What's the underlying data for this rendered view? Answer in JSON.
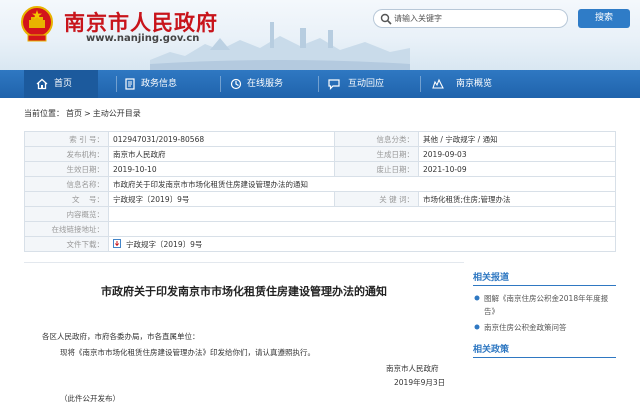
{
  "header": {
    "site_title": "南京市人民政府",
    "site_url": "www.nanjing.gov.cn",
    "search_placeholder": "请输入关键字",
    "search_button": "搜索"
  },
  "nav": {
    "items": [
      {
        "label": "首页",
        "icon": "home-icon",
        "active": true
      },
      {
        "label": "政务信息",
        "icon": "document-icon"
      },
      {
        "label": "在线服务",
        "icon": "service-icon"
      },
      {
        "label": "互动回应",
        "icon": "chat-icon"
      },
      {
        "label": "南京概览",
        "icon": "overview-icon"
      }
    ]
  },
  "breadcrumb": {
    "prefix": "当前位置：",
    "home": "首页",
    "sep": ">",
    "current": "主动公开目录"
  },
  "meta": {
    "index_no_label": "索 引 号：",
    "index_no": "012947031/2019-80568",
    "category_label": "信息分类：",
    "category": "其他 / 宁政规字 / 通知",
    "publisher_label": "发布机构：",
    "publisher": "南京市人民政府",
    "created_label": "生成日期：",
    "created": "2019-09-03",
    "effective_label": "生效日期：",
    "effective": "2019-10-10",
    "abolished_label": "废止日期：",
    "abolished": "2021-10-09",
    "name_label": "信息名称：",
    "name": "市政府关于印发南京市市场化租赁住房建设管理办法的通知",
    "docno_label": "文    号：",
    "docno": "宁政规字〔2019〕9号",
    "keywords_label": "关 键 词：",
    "keywords": "市场化租赁;住房;管理办法",
    "summary_label": "内容概览：",
    "summary": "",
    "online_link_label": "在线链接地址：",
    "online_link": "",
    "download_label": "文件下载：",
    "download": "宁政规字〔2019〕9号"
  },
  "article": {
    "title": "市政府关于印发南京市市场化租赁住房建设管理办法的通知",
    "salutation": "各区人民政府，市府各委办局，市各直属单位：",
    "body": "现将《南京市市场化租赁住房建设管理办法》印发给你们，请认真遵照执行。",
    "signature": "南京市人民政府",
    "date": "2019年9月3日",
    "note": "（此件公开发布）"
  },
  "sidebar": {
    "related_reports_title": "相关报道",
    "related_reports": [
      "图解《南京住房公积金2018年年度报告》",
      "南京住房公积金政策问答"
    ],
    "related_policies_title": "相关政策"
  },
  "colors": {
    "brand_red": "#c8141b",
    "nav_blue": "#1f63ac",
    "link_blue": "#2f78c2"
  }
}
